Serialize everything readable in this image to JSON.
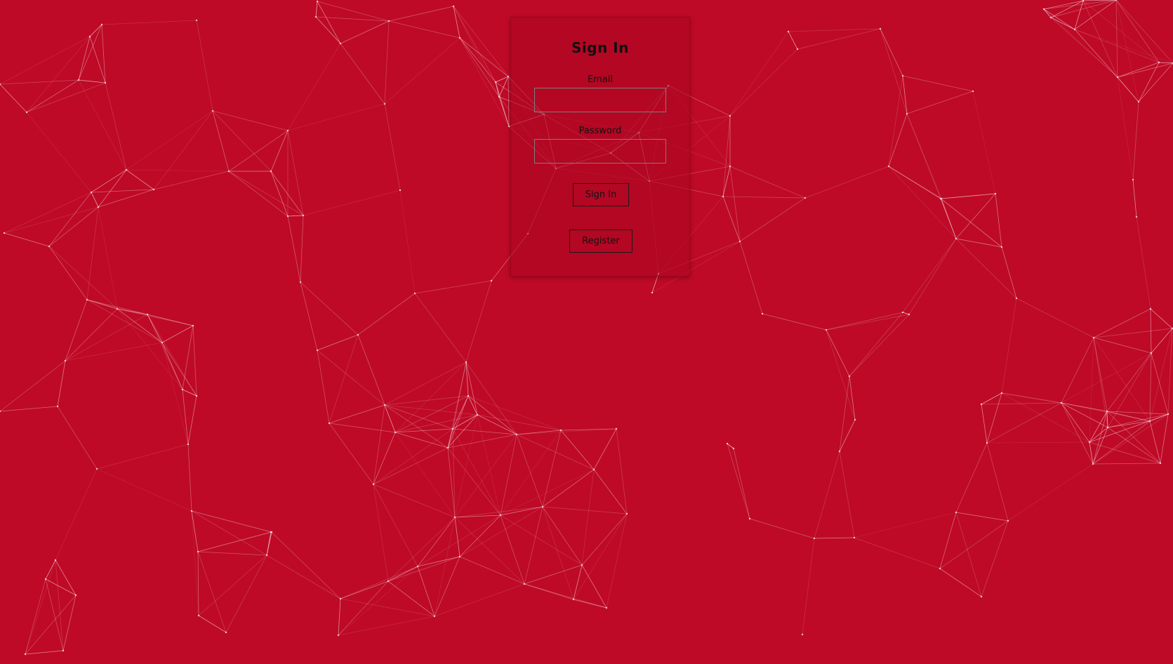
{
  "theme": {
    "background": "#be0a27",
    "line_color": "#f3c7cf",
    "node_color": "#ffe4e8"
  },
  "signin": {
    "title": "Sign In",
    "email_label": "Email",
    "email_value": "",
    "password_label": "Password",
    "password_value": "",
    "signin_button": "Sign In",
    "register_button": "Register"
  }
}
